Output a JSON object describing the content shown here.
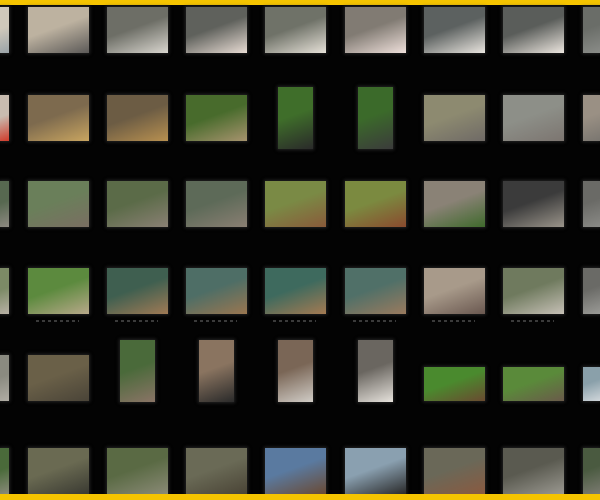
{
  "colors": {
    "accent": "#f5c400",
    "background": "#030303"
  },
  "rows": [
    {
      "thumbs": [
        [
          "#cfc8bb",
          "#9aa3a8"
        ],
        [
          "#bdb2a0",
          "#5c5a58"
        ],
        [
          "#6d6e66",
          "#d9d6cf"
        ],
        [
          "#5f615c",
          "#e8dcd4"
        ],
        [
          "#6f7268",
          "#e6e1d8"
        ],
        [
          "#817b73",
          "#efe0db"
        ],
        [
          "#5c6160",
          "#e9e5df"
        ],
        [
          "#5a5d5a",
          "#ece6df"
        ],
        [
          "#6a6d68",
          "#8a8c88"
        ]
      ],
      "orient": [
        "l",
        "l",
        "l",
        "l",
        "l",
        "l",
        "l",
        "l",
        "l"
      ]
    },
    {
      "thumbs": [
        [
          "#c8bcb0",
          "#d03a2a"
        ],
        [
          "#7d6a4e",
          "#c9a560"
        ],
        [
          "#6c5c44",
          "#b89050"
        ],
        [
          "#486b2c",
          "#a7936e"
        ],
        [
          "#3f6e2a",
          "#2a2a2a"
        ],
        [
          "#3b6a2a",
          "#3b3b3b"
        ],
        [
          "#8d8a70",
          "#6f6a66"
        ],
        [
          "#8d8f88",
          "#7c7570"
        ],
        [
          "#9a9084",
          "#7a7670"
        ]
      ],
      "orient": [
        "l",
        "l",
        "l",
        "l",
        "p",
        "p",
        "l",
        "l",
        "l"
      ]
    },
    {
      "thumbs": [
        [
          "#576850",
          "#8e8a82"
        ],
        [
          "#6a7f5a",
          "#7a6e62"
        ],
        [
          "#5b6b48",
          "#8a8074"
        ],
        [
          "#5d6a58",
          "#8a7f73"
        ],
        [
          "#7a8a45",
          "#8a5a3a"
        ],
        [
          "#7b8a40",
          "#8a4a2e"
        ],
        [
          "#8a8276",
          "#3f6a2c"
        ],
        [
          "#3b3b3b",
          "#9a948a"
        ],
        [
          "#6a6a66",
          "#8a8a86"
        ]
      ],
      "orient": [
        "l",
        "l",
        "l",
        "l",
        "l",
        "l",
        "l",
        "l",
        "l"
      ]
    },
    {
      "thumbs": [
        [
          "#7c8a66",
          "#b9b1a6"
        ],
        [
          "#5c8a3e",
          "#b8a88a"
        ],
        [
          "#3f5f50",
          "#a07a55"
        ],
        [
          "#4e6e66",
          "#9a7650"
        ],
        [
          "#3e6a5e",
          "#a47a52"
        ],
        [
          "#507068",
          "#9a7a5e"
        ],
        [
          "#a89a8a",
          "#6a5850"
        ],
        [
          "#6f7a5e",
          "#c6c0b6"
        ],
        [
          "#6a6a66",
          "#9a9a96"
        ]
      ],
      "orient": [
        "l",
        "l",
        "l",
        "l",
        "l",
        "l",
        "l",
        "l",
        "l"
      ]
    },
    {
      "thumbs": [
        [
          "#8a8a80",
          "#b0aca4"
        ],
        [
          "#6a6048",
          "#4a4438"
        ],
        [
          "#4a6a3a",
          "#8a7466"
        ],
        [
          "#8a7460",
          "#2a2a2a"
        ],
        [
          "#7a6656",
          "#d0ccc6"
        ],
        [
          "#6a6660",
          "#e6e2dc"
        ],
        [
          "#4a8a2e",
          "#6a4a30"
        ],
        [
          "#5a8a3a",
          "#6a5a4a"
        ],
        [
          "#8aa0aa",
          "#d0d6da"
        ]
      ],
      "orient": [
        "l",
        "l",
        "p",
        "p",
        "p",
        "p",
        "l",
        "l",
        "l"
      ]
    },
    {
      "thumbs": [
        [
          "#4a6a3a",
          "#8a8a7a"
        ],
        [
          "#6a6a52",
          "#3a3a32"
        ],
        [
          "#5a6a44",
          "#8a8a76"
        ],
        [
          "#6a6a56",
          "#4a4436"
        ],
        [
          "#5a7aa0",
          "#6a4a34"
        ],
        [
          "#8aa0b0",
          "#2a2a2a"
        ],
        [
          "#6a6858",
          "#8a5a40"
        ],
        [
          "#5a5a50",
          "#9a9890"
        ],
        [
          "#4a5a40",
          "#7a7a70"
        ]
      ],
      "orient": [
        "l",
        "l",
        "l",
        "l",
        "l",
        "l",
        "l",
        "l",
        "l"
      ]
    }
  ]
}
